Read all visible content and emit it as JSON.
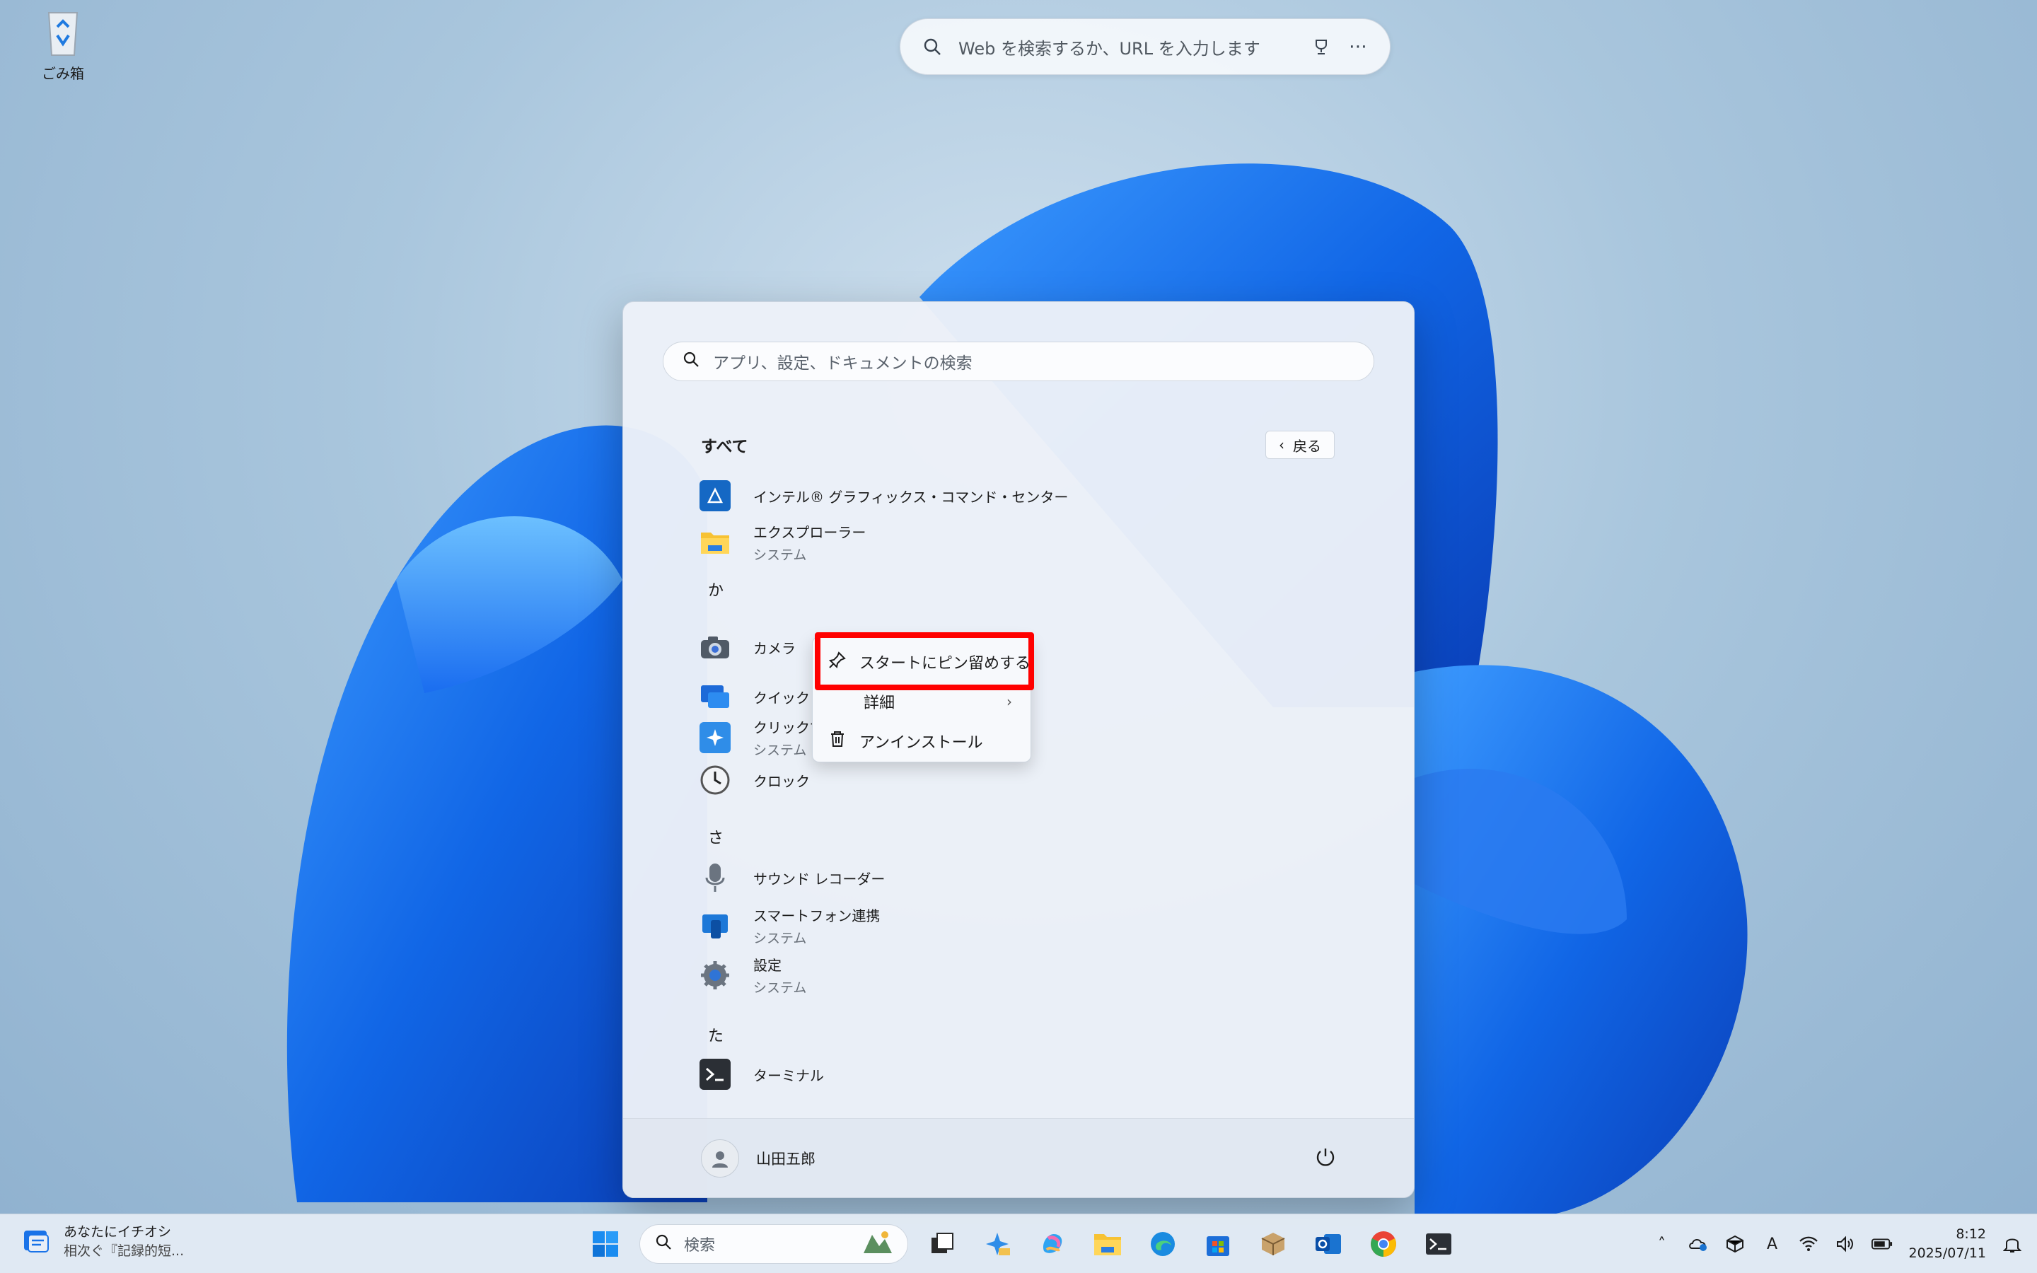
{
  "desktop": {
    "recycle_bin_label": "ごみ箱"
  },
  "web_search": {
    "placeholder": "Web を検索するか、URL を入力します"
  },
  "start_menu": {
    "search_placeholder": "アプリ、設定、ドキュメントの検索",
    "section_title": "すべて",
    "back_label": "戻る",
    "letters": {
      "ka": "か",
      "sa": "さ",
      "ta": "た"
    },
    "apps": [
      {
        "name": "インテル® グラフィックス・コマンド・センター",
        "sub": ""
      },
      {
        "name": "エクスプローラー",
        "sub": "システム"
      },
      {
        "name": "カメラ",
        "sub": ""
      },
      {
        "name": "クイック ア",
        "sub": ""
      },
      {
        "name": "クリックで",
        "sub": "システム"
      },
      {
        "name": "クロック",
        "sub": ""
      },
      {
        "name": "サウンド レコーダー",
        "sub": ""
      },
      {
        "name": "スマートフォン連携",
        "sub": "システム"
      },
      {
        "name": "設定",
        "sub": "システム"
      },
      {
        "name": "ターミナル",
        "sub": ""
      }
    ],
    "user_name": "山田五郎"
  },
  "context_menu": {
    "pin_label": "スタートにピン留めする",
    "details_label": "詳細",
    "uninstall_label": "アンインストール"
  },
  "taskbar": {
    "widget_title": "あなたにイチオシ",
    "widget_sub": "相次ぐ『記録的短...",
    "search_label": "検索",
    "time": "8:12",
    "date": "2025/07/11",
    "ime_label": "A"
  }
}
